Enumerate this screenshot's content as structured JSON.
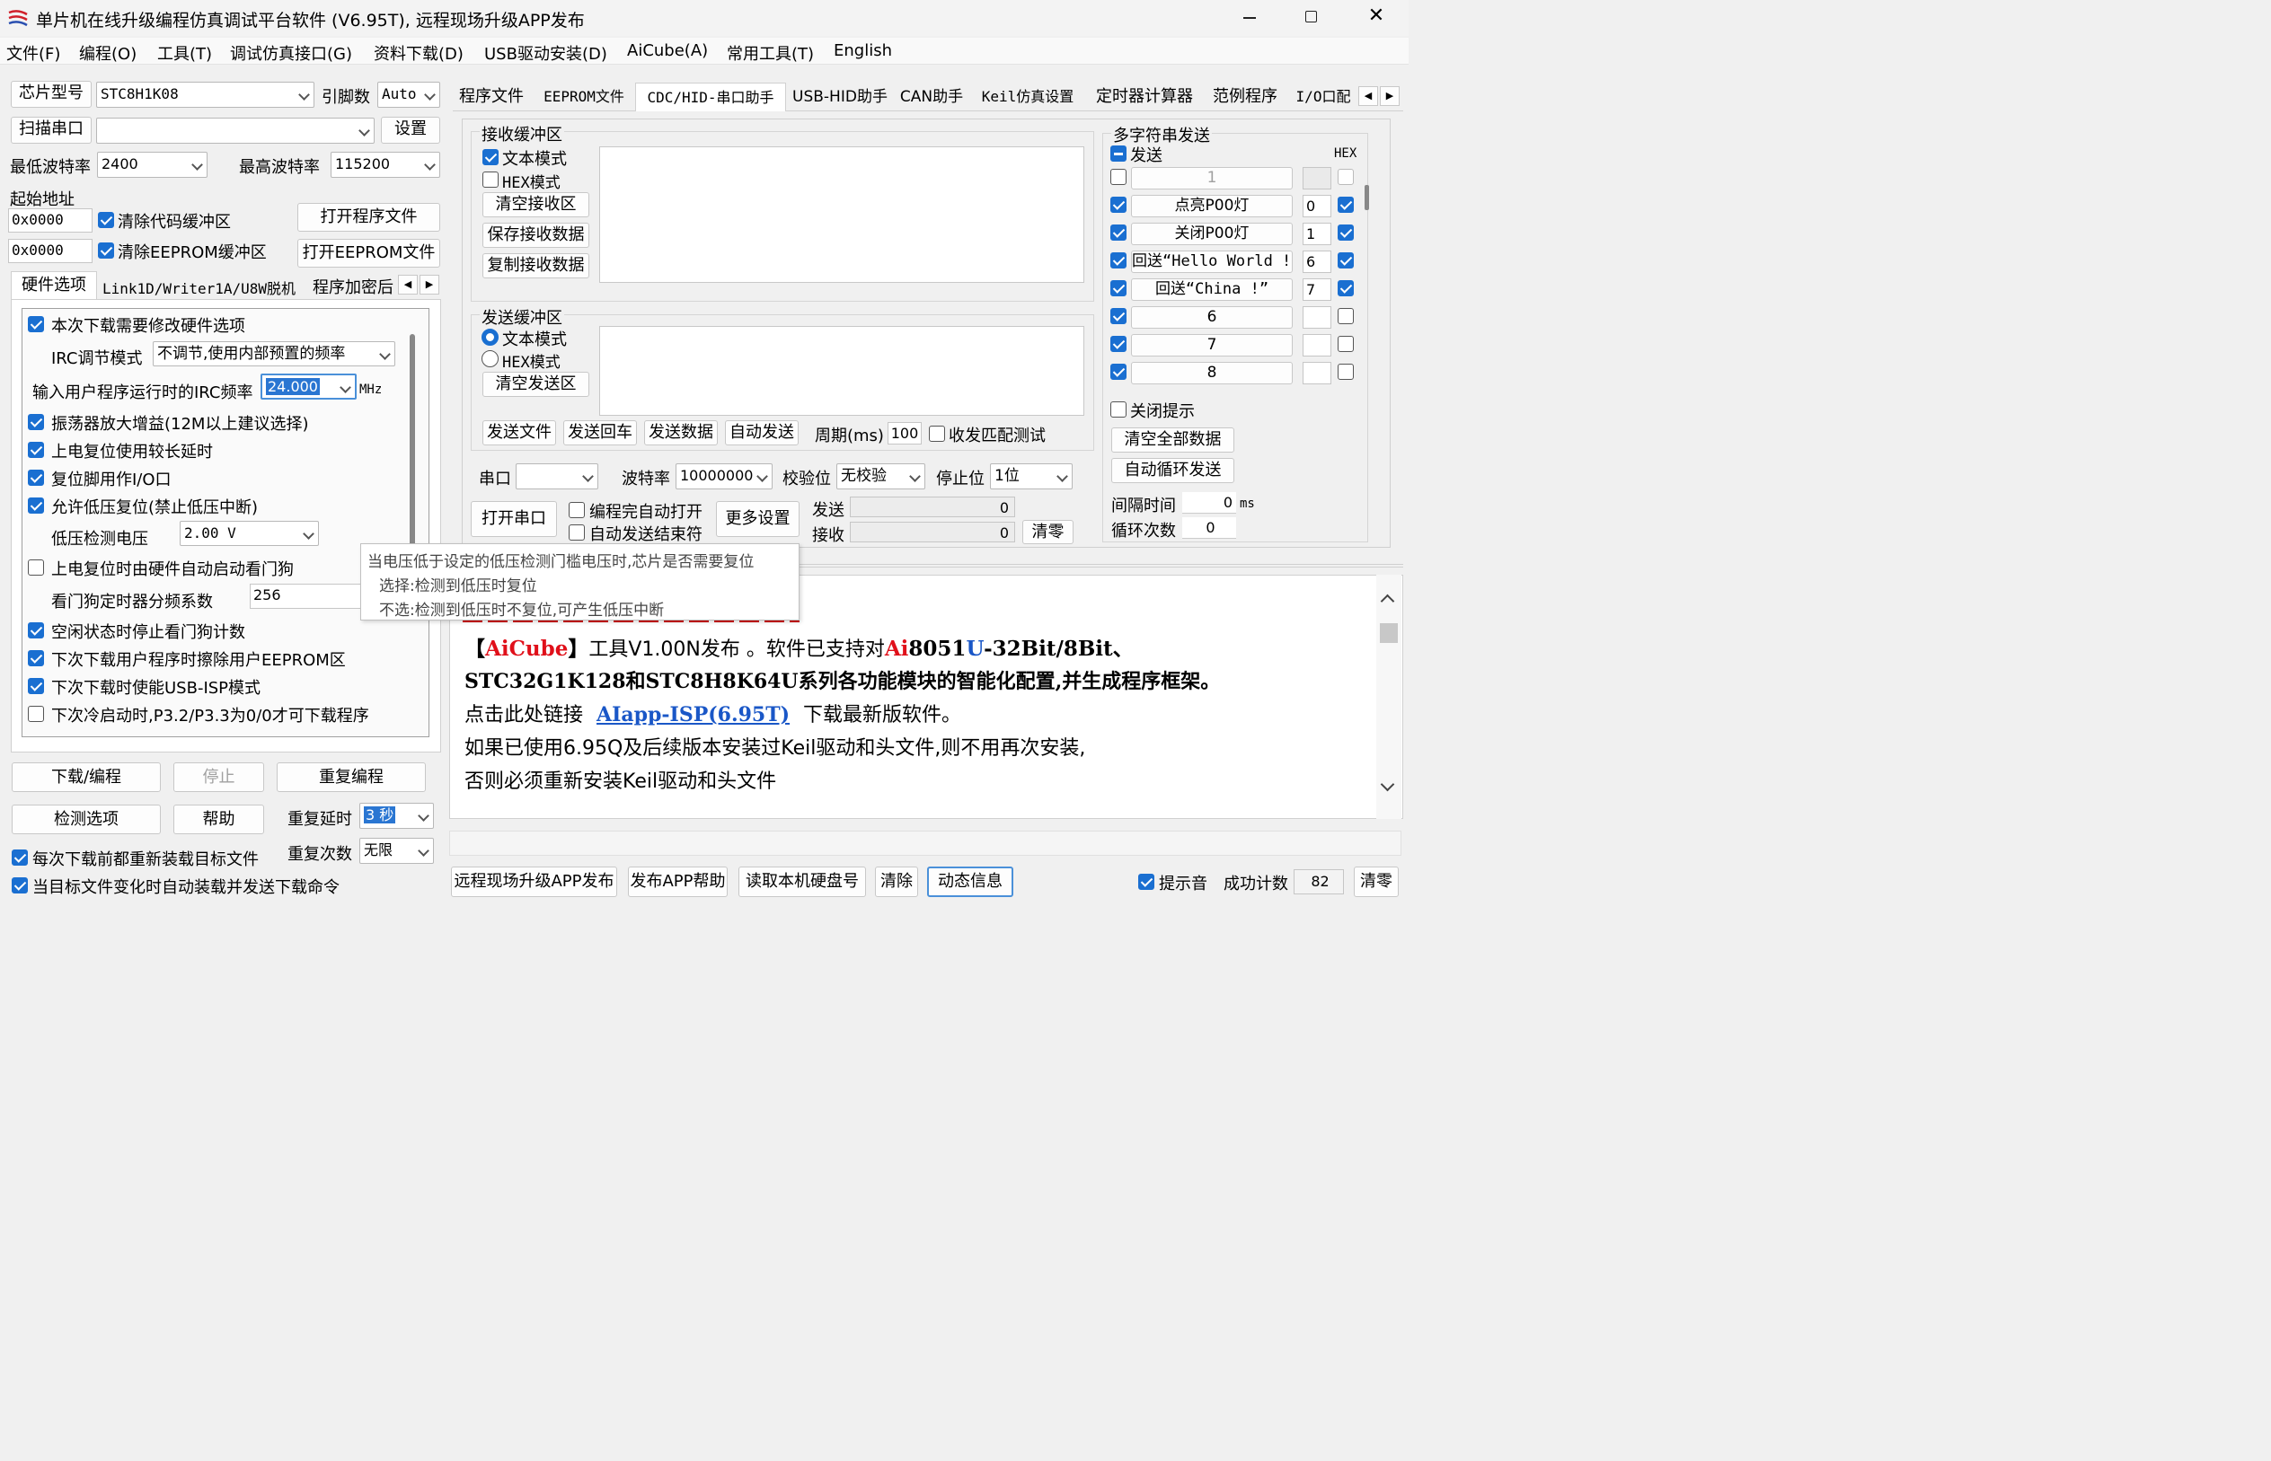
{
  "title": "单片机在线升级编程仿真调试平台软件 (V6.95T), 远程现场升级APP发布",
  "menu": [
    "文件(F)",
    "编程(O)",
    "工具(T)",
    "调试仿真接口(G)",
    "资料下载(D)",
    "USB驱动安装(D)",
    "AiCube(A)",
    "常用工具(T)",
    "English"
  ],
  "left": {
    "chip_label": "芯片型号",
    "chip_value": "STC8H1K08",
    "pins_label": "引脚数",
    "pins_value": "Auto",
    "scan_button": "扫描串口",
    "port_value": "",
    "settings_button": "设置",
    "min_baud_label": "最低波特率",
    "min_baud_value": "2400",
    "max_baud_label": "最高波特率",
    "max_baud_value": "115200",
    "start_addr_label": "起始地址",
    "addr1": "0x0000",
    "clear_code_label": "清除代码缓冲区",
    "open_program_button": "打开程序文件",
    "addr2": "0x0000",
    "clear_eeprom_label": "清除EEPROM缓冲区",
    "open_eeprom_button": "打开EEPROM文件",
    "tabs": [
      "硬件选项",
      "Link1D/Writer1A/U8W脱机",
      "程序加密后"
    ],
    "options": {
      "opt1": "本次下载需要修改硬件选项",
      "irc_mode_label": "IRC调节模式",
      "irc_mode_value": "不调节,使用内部预置的频率",
      "irc_freq_label": "输入用户程序运行时的IRC频率",
      "irc_freq_value": "24.000",
      "irc_unit": "MHz",
      "opt2": "振荡器放大增益(12M以上建议选择)",
      "opt3": "上电复位使用较长延时",
      "opt4": "复位脚用作I/O口",
      "opt5": "允许低压复位(禁止低压中断)",
      "lvd_label": "低压检测电压",
      "lvd_value": "2.00 V",
      "opt6": "上电复位时由硬件自动启动看门狗",
      "wdt_label": "看门狗定时器分频系数",
      "wdt_value": "256",
      "opt7": "空闲状态时停止看门狗计数",
      "opt8": "下次下载用户程序时擦除用户EEPROM区",
      "opt9": "下次下载时使能USB-ISP模式",
      "opt10": "下次冷启动时,P3.2/P3.3为0/0才可下载程序"
    },
    "download_button": "下载/编程",
    "stop_button": "停止",
    "reprogram_button": "重复编程",
    "detect_button": "检测选项",
    "help_button": "帮助",
    "repeat_delay_label": "重复延时",
    "repeat_delay_value": "3 秒",
    "repeat_count_label": "重复次数",
    "repeat_count_value": "无限",
    "reload_label": "每次下载前都重新装载目标文件",
    "autoload_label": "当目标文件变化时自动装载并发送下载命令"
  },
  "right_tabs": [
    "程序文件",
    "EEPROM文件",
    "CDC/HID-串口助手",
    "USB-HID助手",
    "CAN助手",
    "Keil仿真设置",
    "定时器计算器",
    "范例程序",
    "I/O口配"
  ],
  "serial": {
    "rx_group": "接收缓冲区",
    "rx_text_mode": "文本模式",
    "rx_hex_mode": "HEX模式",
    "clear_rx": "清空接收区",
    "save_rx": "保存接收数据",
    "copy_rx": "复制接收数据",
    "tx_group": "发送缓冲区",
    "tx_text_mode": "文本模式",
    "tx_hex_mode": "HEX模式",
    "clear_tx": "清空发送区",
    "send_file": "发送文件",
    "send_cr": "发送回车",
    "send_data": "发送数据",
    "auto_send": "自动发送",
    "period_label": "周期(ms)",
    "period_value": "100",
    "match_test": "收发匹配测试",
    "port_label": "串口",
    "port_value": "",
    "baud_label": "波特率",
    "baud_value": "10000000",
    "parity_label": "校验位",
    "parity_value": "无校验",
    "stop_label": "停止位",
    "stop_value": "1位",
    "open_port": "打开串口",
    "auto_open": "编程完自动打开",
    "auto_end": "自动发送结束符",
    "more_settings": "更多设置",
    "send_label": "发送",
    "send_count": "0",
    "recv_label": "接收",
    "recv_count": "0",
    "clear_count": "清零"
  },
  "multi": {
    "title": "多字符串发送",
    "send_header": "发送",
    "hex_header": "HEX",
    "rows": [
      {
        "label": "1",
        "num": "",
        "checked": false,
        "hex": false
      },
      {
        "label": "点亮P00灯",
        "num": "0",
        "checked": true,
        "hex": true
      },
      {
        "label": "关闭P00灯",
        "num": "1",
        "checked": true,
        "hex": true
      },
      {
        "label": "回送“Hello World !”",
        "num": "6",
        "checked": true,
        "hex": true
      },
      {
        "label": "回送“China !”",
        "num": "7",
        "checked": true,
        "hex": true
      },
      {
        "label": "6",
        "num": "",
        "checked": true,
        "hex": false
      },
      {
        "label": "7",
        "num": "",
        "checked": true,
        "hex": false
      },
      {
        "label": "8",
        "num": "",
        "checked": true,
        "hex": false
      }
    ],
    "close_prompt": "关闭提示",
    "clear_all": "清空全部数据",
    "auto_loop": "自动循环发送",
    "interval_label": "间隔时间",
    "interval_value": "0",
    "interval_unit": "ms",
    "loop_label": "循环次数",
    "loop_value": "0"
  },
  "tooltip": {
    "line1": "当电压低于设定的低压检测门槛电压时,芯片是否需要复位",
    "line2": "选择:检测到低压时复位",
    "line3": "不选:检测到低压时不复位,可产生低压中断"
  },
  "info": {
    "l1_bracket_open": "【",
    "l1_name": "AiCube",
    "l1_bracket_close": "】",
    "l1_rest_a": "工具V1.00N发布 。软件已支持对",
    "l1_red_ai": "Ai",
    "l1_mid": "8051",
    "l1_blue_u": "U",
    "l1_tail": "-32Bit/8Bit、",
    "l2": "STC32G1K128和STC8H8K64U系列各功能模块的智能化配置,并生成程序框架。",
    "l3_a": "点击此处链接",
    "l3_link": "AIapp-ISP(6.95T)",
    "l3_b": "下载最新版软件。",
    "l4": "如果已使用6.95Q及后续版本安装过Keil驱动和头文件,则不用再次安装,",
    "l5": "否则必须重新安装Keil驱动和头文件"
  },
  "bottom": {
    "remote_publish": "远程现场升级APP发布",
    "publish_help": "发布APP帮助",
    "read_disk": "读取本机硬盘号",
    "clear": "清除",
    "dynamic_info": "动态信息",
    "sound_label": "提示音",
    "success_label": "成功计数",
    "success_value": "82",
    "clear_zero": "清零"
  },
  "colors": {
    "accent": "#1a6fd1",
    "red": "#e0101a",
    "link": "#1a57c7"
  }
}
